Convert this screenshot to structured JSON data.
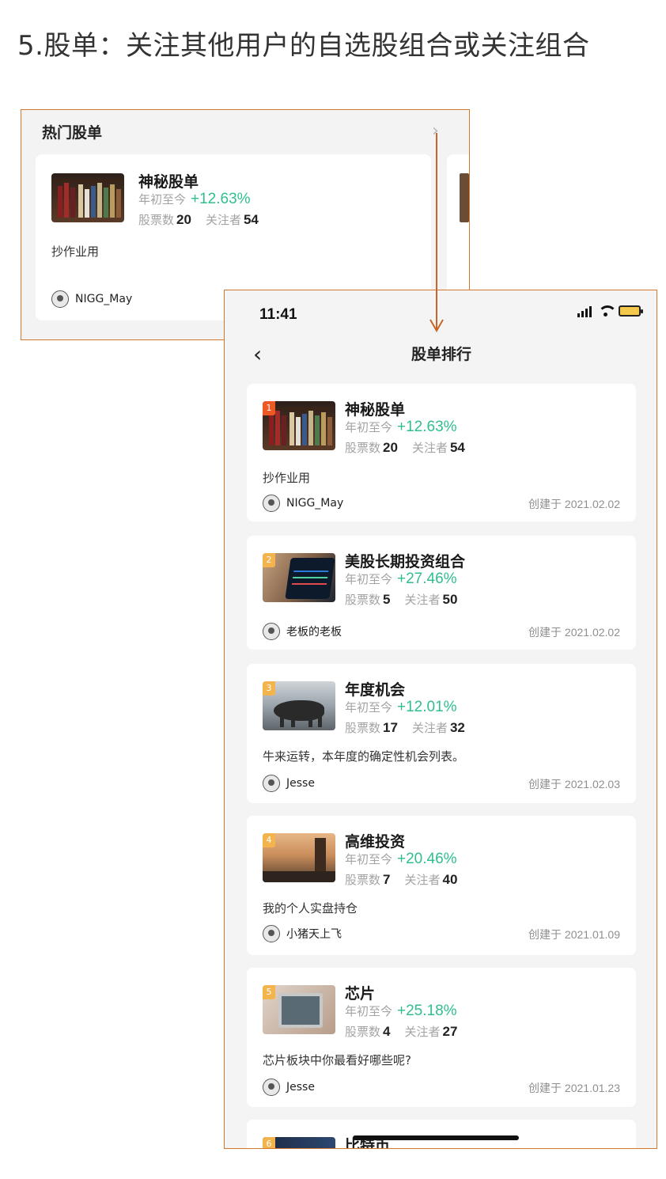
{
  "heading": "5.股单：关注其他用户的自选股组合或关注组合",
  "preview": {
    "title": "热门股单",
    "chevron": "›",
    "card": {
      "name": "神秘股单",
      "ytd_label": "年初至今",
      "ytd_value": "+12.63%",
      "stocks_label": "股票数",
      "stocks_value": "20",
      "followers_label": "关注者",
      "followers_value": "54",
      "desc": "抄作业用",
      "user": "NIGG_May"
    }
  },
  "phone": {
    "time": "11:41",
    "back": "‹",
    "title": "股单排行",
    "ytd_label": "年初至今",
    "stocks_label": "股票数",
    "followers_label": "关注者",
    "cards": [
      {
        "rank": "1",
        "name": "神秘股单",
        "ytd": "+12.63%",
        "stocks": "20",
        "followers": "54",
        "desc": "抄作业用",
        "user": "NIGG_May",
        "created": "创建于 2021.02.02"
      },
      {
        "rank": "2",
        "name": "美股长期投资组合",
        "ytd": "+27.46%",
        "stocks": "5",
        "followers": "50",
        "desc": "",
        "user": "老板的老板",
        "created": "创建于 2021.02.02"
      },
      {
        "rank": "3",
        "name": "年度机会",
        "ytd": "+12.01%",
        "stocks": "17",
        "followers": "32",
        "desc": "牛来运转，本年度的确定性机会列表。",
        "user": "Jesse",
        "created": "创建于 2021.02.03"
      },
      {
        "rank": "4",
        "name": "高维投资",
        "ytd": "+20.46%",
        "stocks": "7",
        "followers": "40",
        "desc": "我的个人实盘持仓",
        "user": "小猪天上飞",
        "created": "创建于 2021.01.09"
      },
      {
        "rank": "5",
        "name": "芯片",
        "ytd": "+25.18%",
        "stocks": "4",
        "followers": "27",
        "desc": "芯片板块中你最看好哪些呢?",
        "user": "Jesse",
        "created": "创建于 2021.01.23"
      },
      {
        "rank": "6",
        "name": "比特币",
        "ytd": "",
        "stocks": "",
        "followers": "",
        "desc": "",
        "user": "",
        "created": ""
      }
    ]
  },
  "colors": {
    "accent_border": "#d2792f",
    "positive": "#2fbf8f",
    "rank_top": "#ee5a24",
    "rank_other": "#f3b34d"
  },
  "icons": [
    "chevron-right-icon",
    "back-chevron-icon",
    "signal-icon",
    "wifi-icon",
    "battery-icon",
    "avatar-icon"
  ]
}
